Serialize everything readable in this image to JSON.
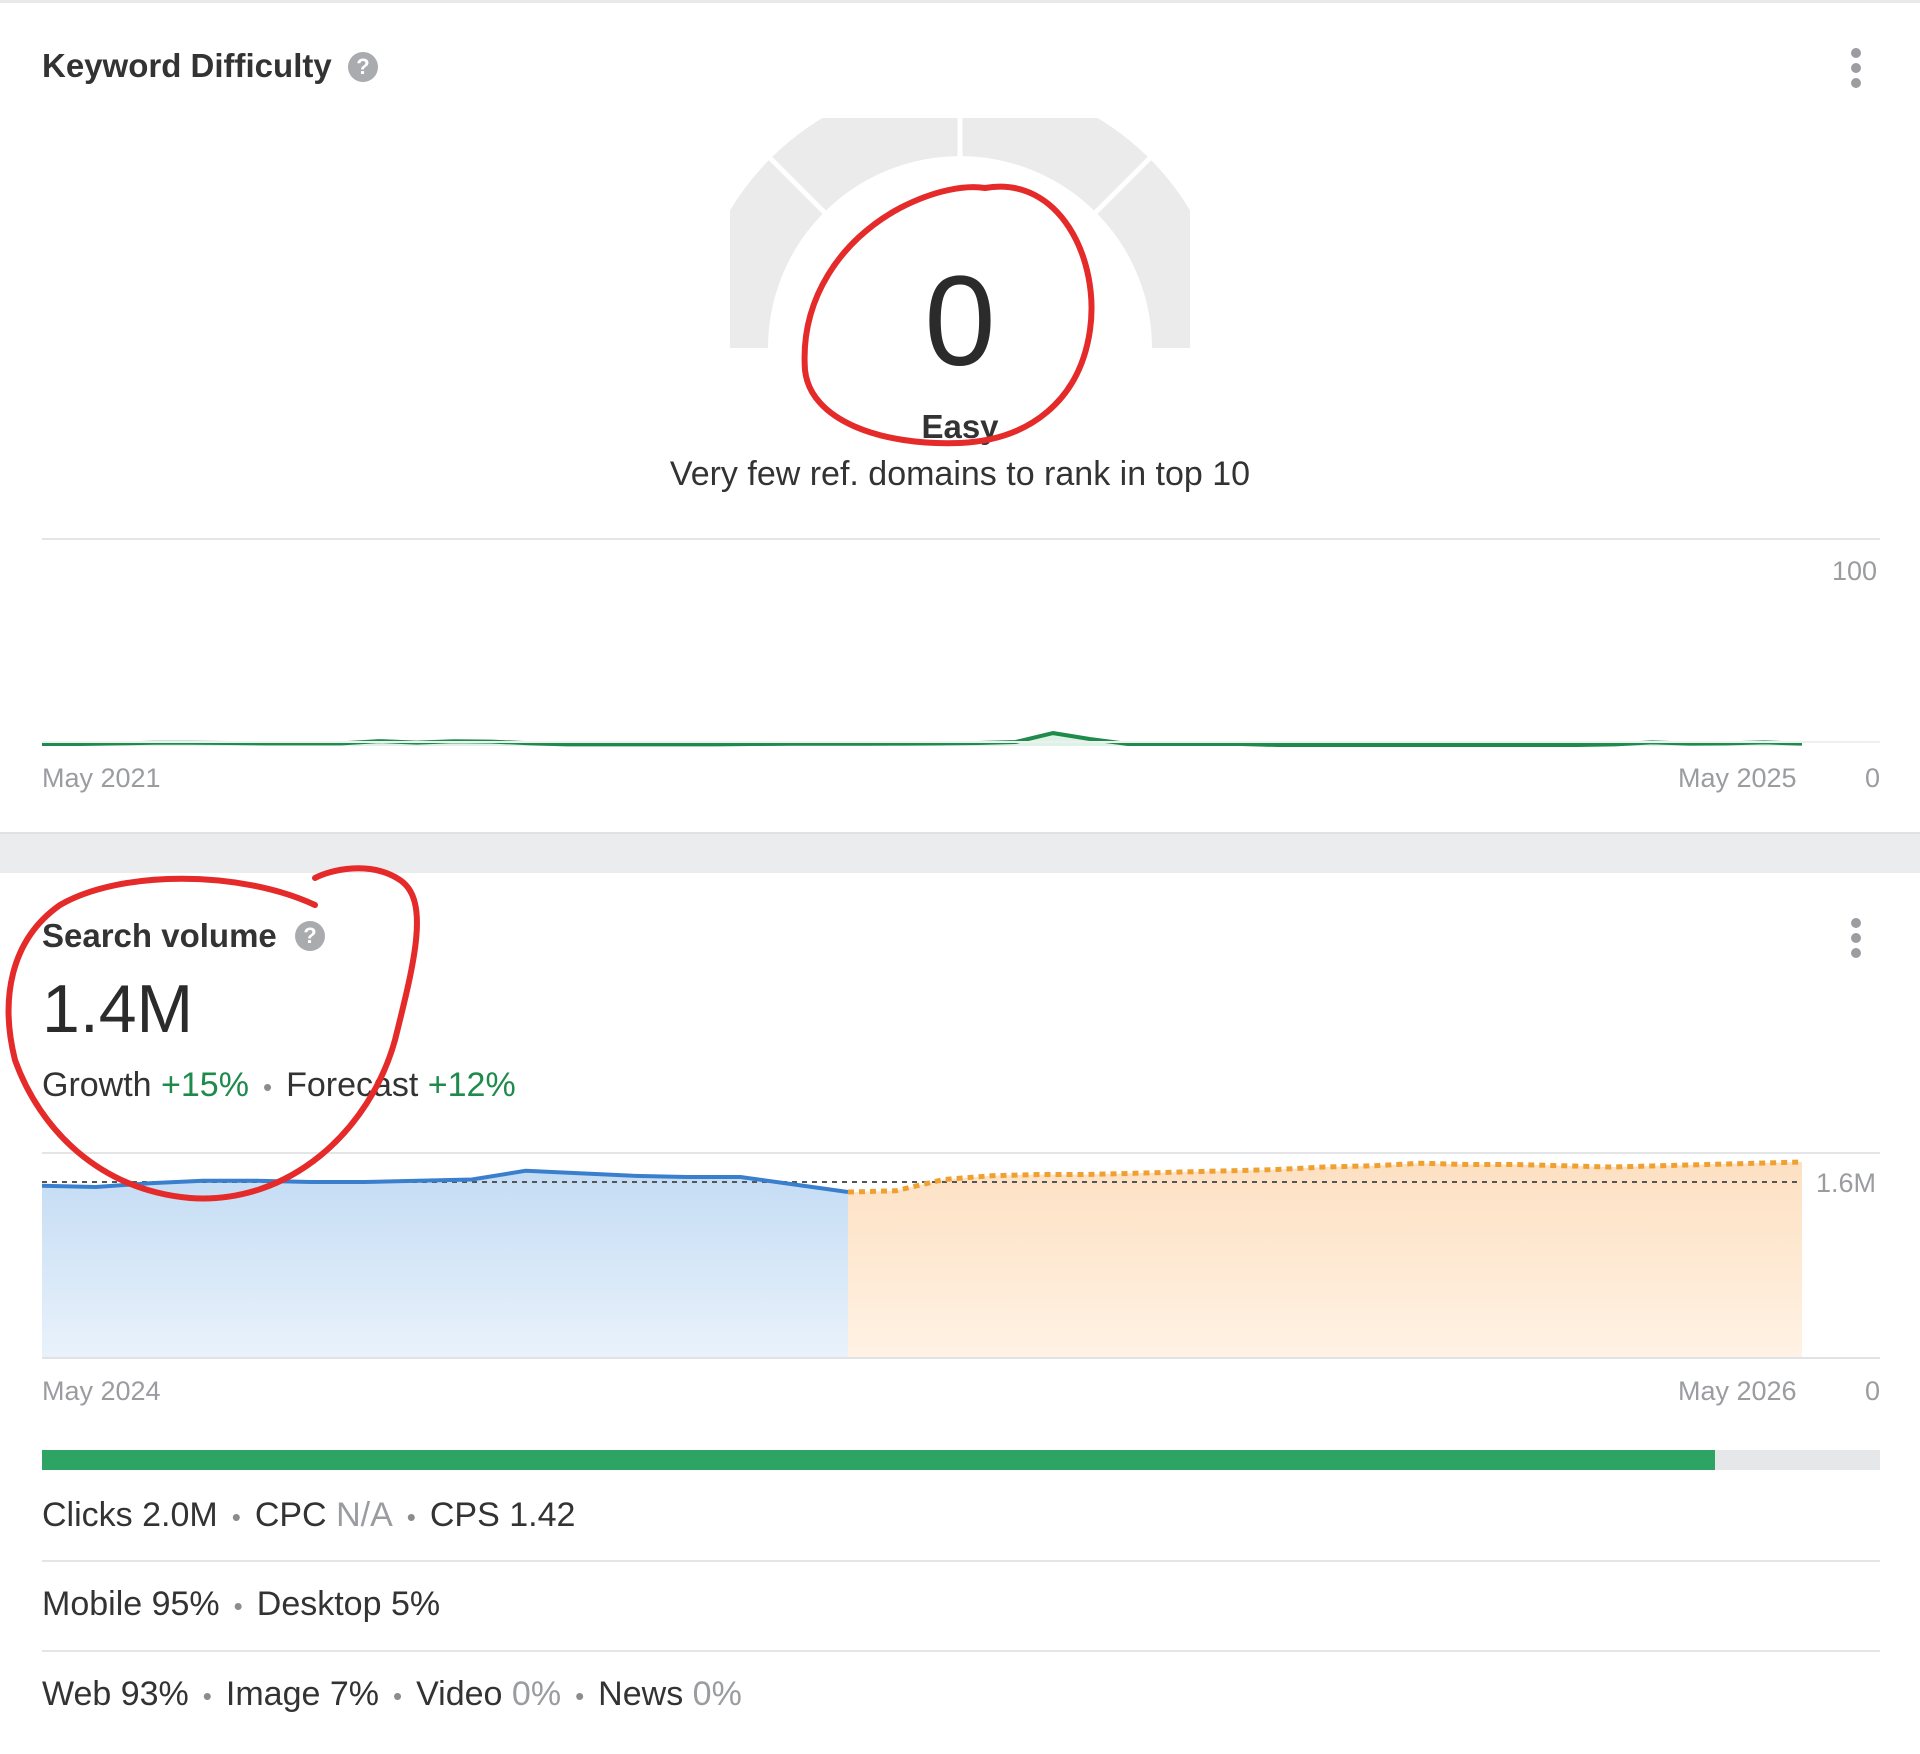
{
  "keyword_difficulty": {
    "title": "Keyword Difficulty",
    "help_icon": "question-circle-icon",
    "menu_icon": "more-vertical-icon",
    "score": "0",
    "label": "Easy",
    "description": "Very few ref. domains to rank in top 10",
    "gauge_value": 0,
    "accent_color": "#1e8a4c"
  },
  "kd_chart_data": {
    "type": "area",
    "x_start_label": "May 2021",
    "x_end_label": "May 2025",
    "y_max_label": "100",
    "y_min_label": "0",
    "ylim": [
      0,
      100
    ],
    "values": [
      1,
      1,
      1.3,
      1.6,
      1.6,
      1.5,
      1.3,
      1.3,
      1.3,
      2.5,
      1.7,
      2.4,
      2.2,
      1.4,
      0.8,
      0.8,
      0.8,
      0.8,
      0.8,
      1,
      1.1,
      1.1,
      1.1,
      1.2,
      1.3,
      1.5,
      2,
      6.5,
      3.5,
      1,
      1,
      1,
      1,
      0.5,
      0.5,
      0.5,
      0.5,
      0.5,
      0.5,
      0.5,
      0.5,
      0.5,
      0.8,
      1.8,
      1.2,
      1.3,
      1.8,
      1.2
    ]
  },
  "search_volume": {
    "title": "Search volume",
    "help_icon": "question-circle-icon",
    "menu_icon": "more-vertical-icon",
    "value": "1.4M",
    "growth_label": "Growth",
    "growth_value": "+15%",
    "forecast_label": "Forecast",
    "forecast_value": "+12%"
  },
  "sv_chart_data": {
    "type": "area",
    "x_start_label": "May 2024",
    "x_end_label": "May 2026",
    "y_max_label": "1.6M",
    "y_min_label": "0",
    "ylim": [
      0,
      1.6
    ],
    "reference_line": 1.4,
    "historical": {
      "color": "#3a7fce",
      "values": [
        1.37,
        1.36,
        1.39,
        1.41,
        1.41,
        1.4,
        1.4,
        1.41,
        1.42,
        1.49,
        1.47,
        1.45,
        1.44,
        1.44,
        1.38,
        1.32
      ]
    },
    "forecast": {
      "color": "#f0a030",
      "values": [
        1.32,
        1.33,
        1.42,
        1.45,
        1.46,
        1.46,
        1.47,
        1.48,
        1.49,
        1.5,
        1.52,
        1.53,
        1.55,
        1.54,
        1.54,
        1.53,
        1.52,
        1.53,
        1.54,
        1.55,
        1.56
      ]
    }
  },
  "click_share_bar": {
    "fill_fraction": 0.91,
    "color": "#2ea464"
  },
  "metrics": {
    "clicks": "Clicks 2.0M",
    "cpc_label": "CPC",
    "cpc_value": "N/A",
    "cps": "CPS 1.42",
    "mobile": "Mobile 95%",
    "desktop": "Desktop 5%",
    "web": "Web 93%",
    "image": "Image 7%",
    "video_label": "Video",
    "video_value": "0%",
    "news_label": "News",
    "news_value": "0%"
  }
}
